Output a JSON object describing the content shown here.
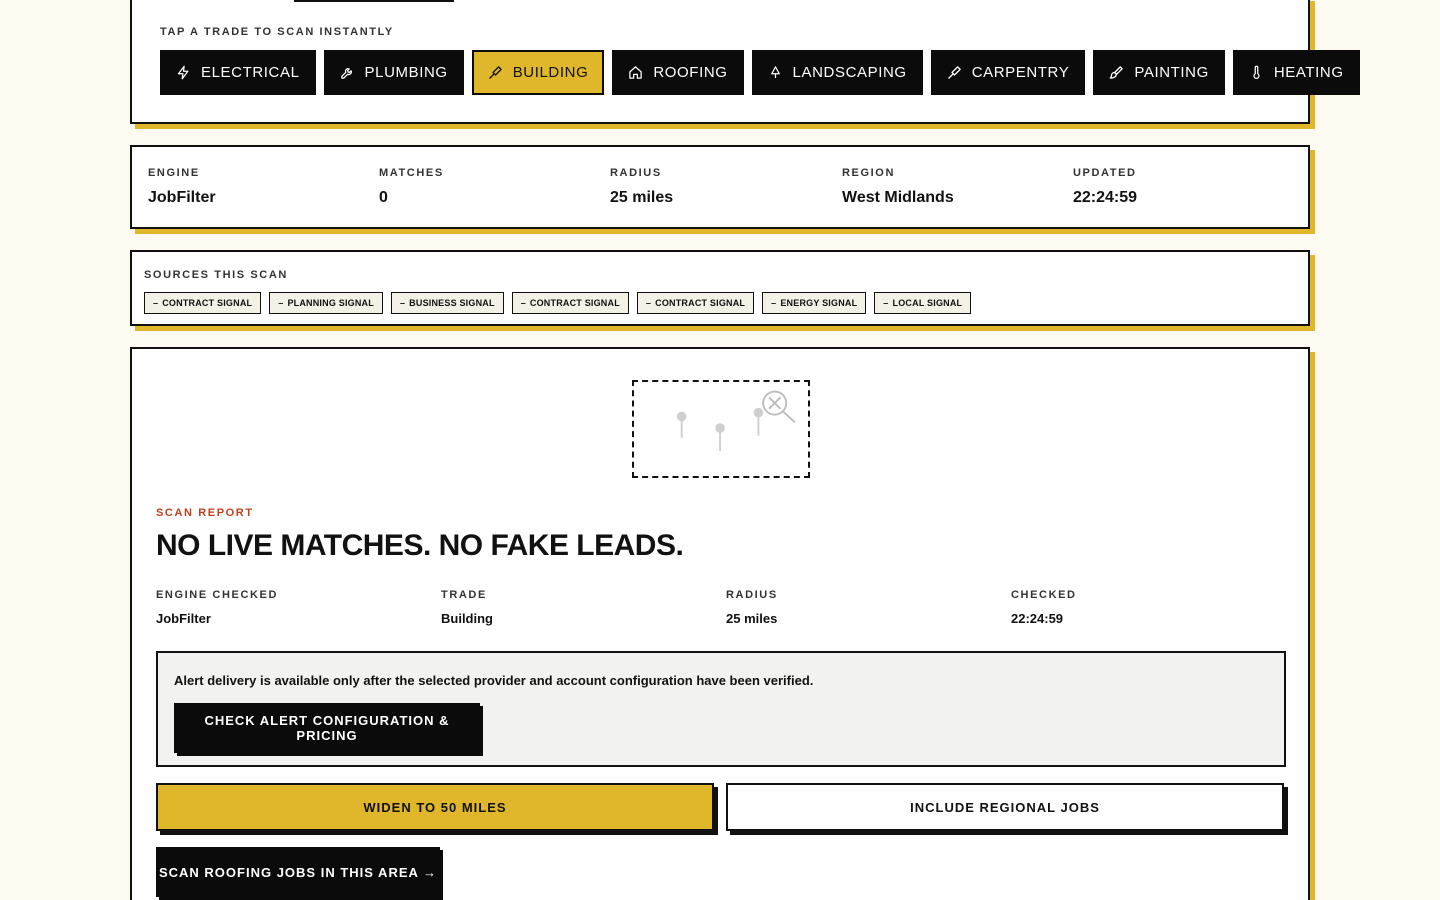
{
  "trades": {
    "label": "TAP A TRADE TO SCAN INSTANTLY",
    "items": [
      {
        "label": "ELECTRICAL",
        "icon": "lightning-icon"
      },
      {
        "label": "PLUMBING",
        "icon": "wrench-icon"
      },
      {
        "label": "BUILDING",
        "icon": "hammer-icon",
        "active": true
      },
      {
        "label": "ROOFING",
        "icon": "house-icon"
      },
      {
        "label": "LANDSCAPING",
        "icon": "tree-icon"
      },
      {
        "label": "CARPENTRY",
        "icon": "hammer-icon"
      },
      {
        "label": "PAINTING",
        "icon": "paintbrush-icon"
      },
      {
        "label": "HEATING",
        "icon": "thermometer-icon"
      }
    ]
  },
  "stats": {
    "engine": {
      "label": "ENGINE",
      "value": "JobFilter"
    },
    "matches": {
      "label": "MATCHES",
      "value": "0"
    },
    "radius": {
      "label": "RADIUS",
      "value": "25 miles"
    },
    "region": {
      "label": "REGION",
      "value": "West Midlands"
    },
    "updated": {
      "label": "UPDATED",
      "value": "22:24:59"
    }
  },
  "sources": {
    "label": "SOURCES THIS SCAN",
    "chips": [
      "CONTRACT SIGNAL",
      "PLANNING SIGNAL",
      "BUSINESS SIGNAL",
      "CONTRACT SIGNAL",
      "CONTRACT SIGNAL",
      "ENERGY SIGNAL",
      "LOCAL SIGNAL"
    ]
  },
  "report": {
    "kicker": "SCAN REPORT",
    "title": "NO LIVE MATCHES. NO FAKE LEADS.",
    "engine_checked": {
      "label": "ENGINE CHECKED",
      "value": "JobFilter"
    },
    "trade": {
      "label": "TRADE",
      "value": "Building"
    },
    "radius": {
      "label": "RADIUS",
      "value": "25 miles"
    },
    "checked": {
      "label": "CHECKED",
      "value": "22:24:59"
    },
    "alert_text": "Alert delivery is available only after the selected provider and account configuration have been verified.",
    "alert_button": "CHECK ALERT CONFIGURATION & PRICING",
    "widen_button": "WIDEN TO 50 MILES",
    "regional_button": "INCLUDE REGIONAL JOBS",
    "roofing_button": "SCAN ROOFING JOBS IN THIS AREA →"
  },
  "colors": {
    "accent": "#e0b62b",
    "background": "#fdfbf1",
    "kicker": "#c2411e",
    "dark": "#0b0b0b"
  }
}
